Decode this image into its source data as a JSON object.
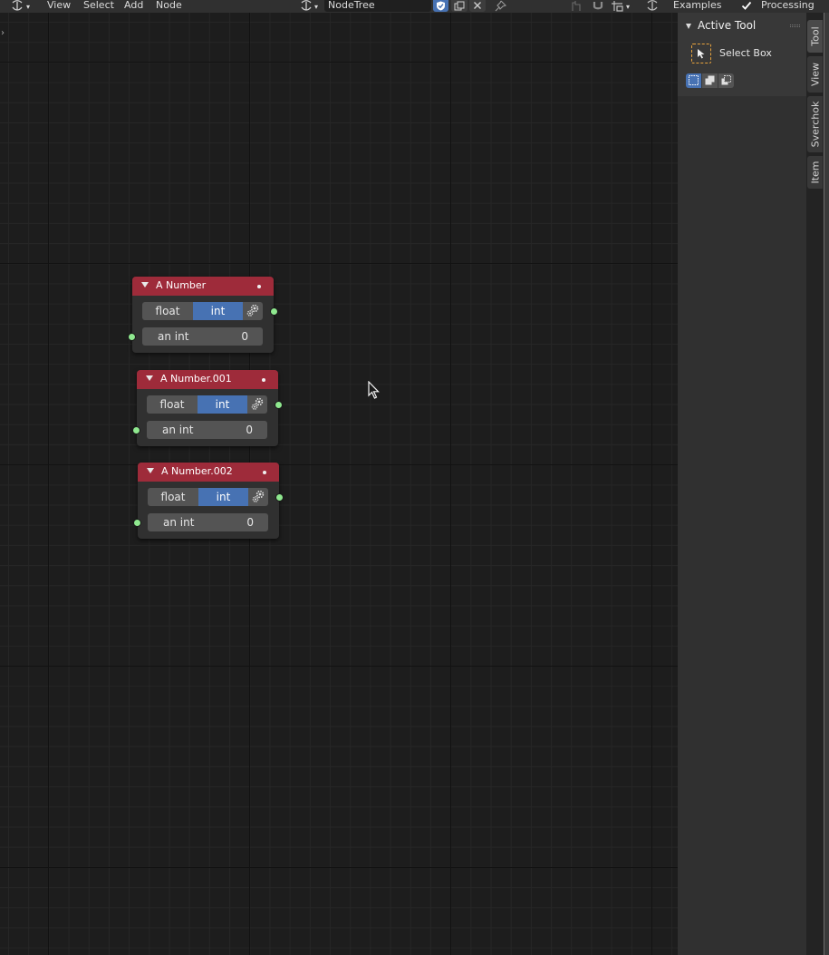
{
  "header": {
    "menus": [
      "View",
      "Select",
      "Add",
      "Node"
    ],
    "tree_name": "NodeTree",
    "examples_label": "Examples",
    "processing_label": "Processing"
  },
  "nodes": [
    {
      "title": "A Number",
      "mode_float": "float",
      "mode_int": "int",
      "field_label": "an int",
      "field_value": "0"
    },
    {
      "title": "A Number.001",
      "mode_float": "float",
      "mode_int": "int",
      "field_label": "an int",
      "field_value": "0"
    },
    {
      "title": "A Number.002",
      "mode_float": "float",
      "mode_int": "int",
      "field_label": "an int",
      "field_value": "0"
    }
  ],
  "sidebar": {
    "panel_title": "Active Tool",
    "tool_label": "Select Box",
    "tabs": [
      "Tool",
      "View",
      "Sverchok",
      "Item"
    ]
  },
  "colors": {
    "node_header": "#9e2b3a",
    "int_active": "#4772b3",
    "socket": "#8fe88f",
    "tool_outline": "#e8a33d"
  }
}
